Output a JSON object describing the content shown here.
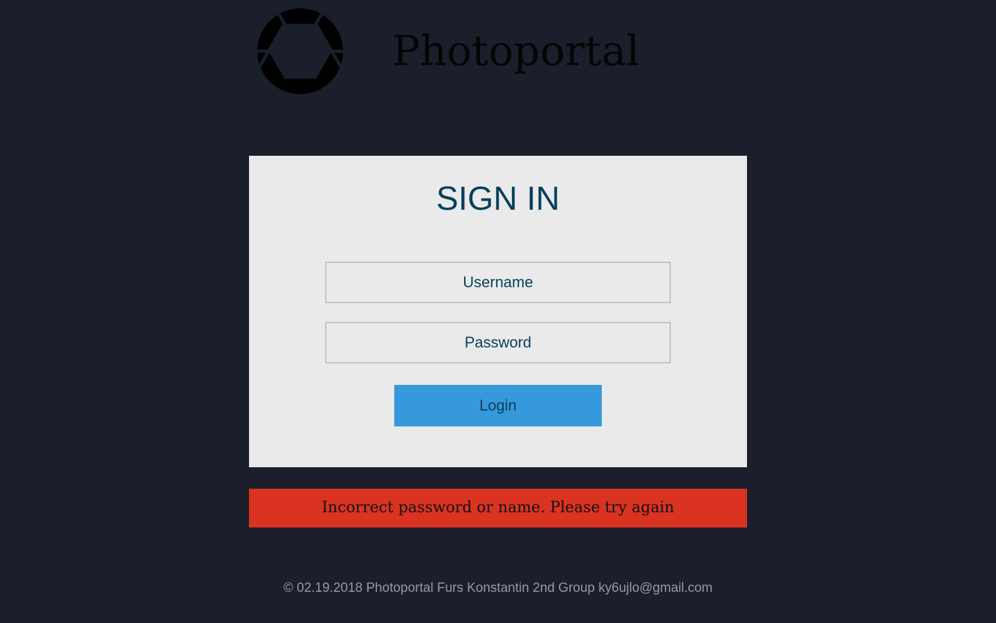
{
  "header": {
    "logo_icon": "camera-aperture-icon",
    "brand_name": "Photoportal"
  },
  "login_form": {
    "title": "SIGN IN",
    "username": {
      "placeholder": "Username",
      "value": ""
    },
    "password": {
      "placeholder": "Password",
      "value": ""
    },
    "submit_label": "Login"
  },
  "error": {
    "message": "Incorrect password or name. Please try again"
  },
  "footer": {
    "text": "© 02.19.2018 Photoportal Furs Konstantin 2nd Group ky6ujlo@gmail.com"
  },
  "colors": {
    "background": "#1b1f2c",
    "card": "#eaeaea",
    "title_text": "#063f5c",
    "button": "#3799dc",
    "error": "#db3321",
    "footer_text": "#9a9a9a"
  }
}
